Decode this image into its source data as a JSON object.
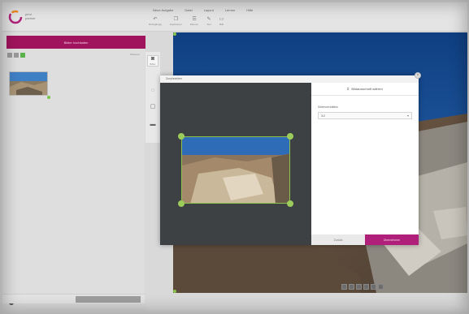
{
  "app": {
    "logo_text": [
      "print",
      "partner"
    ]
  },
  "menu": [
    "Neue Aufgabe",
    "Datei",
    "Layout",
    "Lernen",
    "Hilfe"
  ],
  "toolbar": [
    {
      "icon": "undo-icon",
      "label": "Rückgängig"
    },
    {
      "icon": "copy-icon",
      "label": "Duplizieren"
    },
    {
      "icon": "layers-icon",
      "label": "Ebenen"
    },
    {
      "icon": "pen-icon",
      "label": "Text"
    },
    {
      "icon": "image-icon",
      "label": "Bild"
    }
  ],
  "left": {
    "upload_button": "Bilder hochladen",
    "sort_label": "Sortieren",
    "upload_hint": "",
    "notice": "",
    "info_text": "",
    "download_button": ""
  },
  "vtools": [
    {
      "icon": "camera-icon",
      "label": "Bilder",
      "active": true
    },
    {
      "icon": "text-icon",
      "label": ""
    },
    {
      "icon": "frame-icon",
      "label": ""
    },
    {
      "icon": "background-icon",
      "label": ""
    }
  ],
  "dialog": {
    "title": "Zuschneiden",
    "side_title": "Bildausschnitt wählen",
    "ratio_label": "Seitenverhältnis",
    "ratio_value": "3:2",
    "cancel": "Zurück",
    "apply": "Übernehmen"
  },
  "bottom": {
    "left": "",
    "right": ""
  },
  "colors": {
    "accent": "#a0135d",
    "handle": "#8bc34a"
  }
}
